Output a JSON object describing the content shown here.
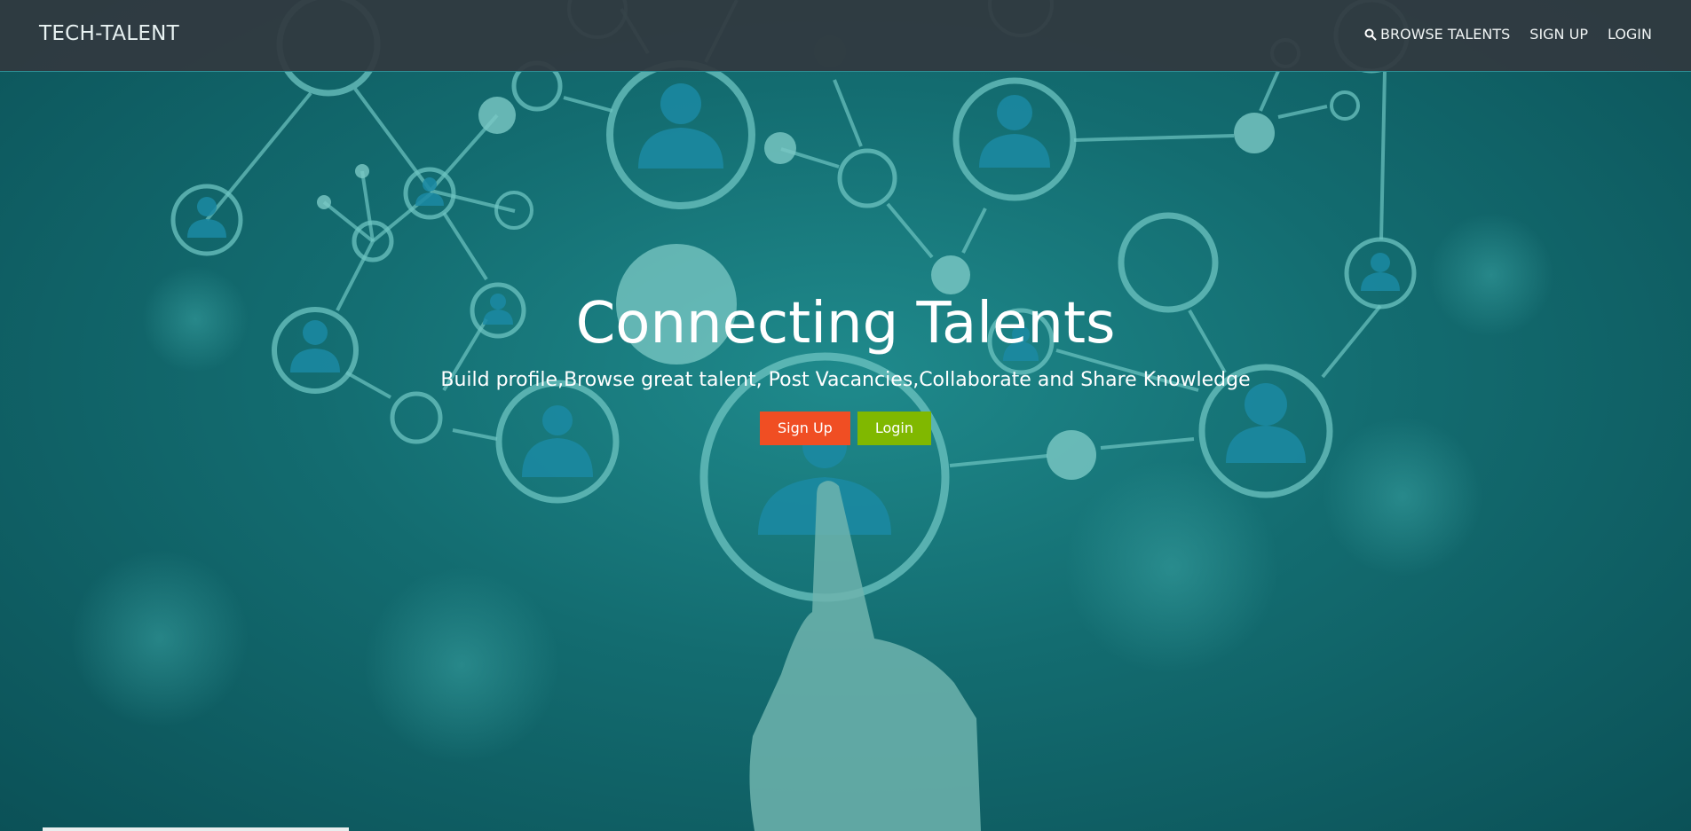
{
  "navbar": {
    "brand": "TECH-TALENT",
    "links": [
      {
        "label": "BROWSE TALENTS",
        "icon": "search-icon"
      },
      {
        "label": "SIGN UP"
      },
      {
        "label": "LOGIN"
      }
    ]
  },
  "hero": {
    "title": "Connecting Talents",
    "subtitle": "Build profile,Browse great talent, Post Vacancies,Collaborate and Share Knowledge",
    "signup_label": "Sign Up",
    "login_label": "Login"
  },
  "colors": {
    "navbar_bg": "#32393f",
    "hero_bg": "#136c70",
    "signup_btn": "#f04e23",
    "login_btn": "#80b800"
  }
}
